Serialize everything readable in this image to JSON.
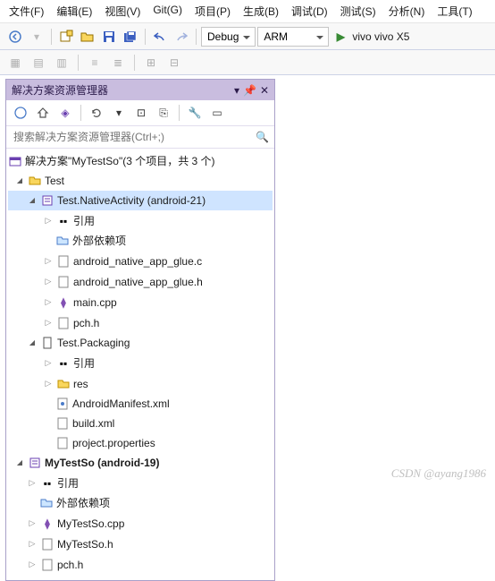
{
  "menu": [
    "文件(F)",
    "编辑(E)",
    "视图(V)",
    "Git(G)",
    "项目(P)",
    "生成(B)",
    "调试(D)",
    "测试(S)",
    "分析(N)",
    "工具(T)"
  ],
  "toolbar": {
    "config": "Debug",
    "platform": "ARM",
    "target": "vivo vivo X5"
  },
  "panel": {
    "title": "解决方案资源管理器",
    "search_placeholder": "搜索解决方案资源管理器(Ctrl+;)",
    "solution": "解决方案\"MyTestSo\"(3 个项目，共 3 个)",
    "nodes": {
      "test": "Test",
      "native": "Test.NativeActivity (android-21)",
      "ref1": "引用",
      "ext1": "外部依赖项",
      "glue_c": "android_native_app_glue.c",
      "glue_h": "android_native_app_glue.h",
      "main": "main.cpp",
      "pch1": "pch.h",
      "pkg": "Test.Packaging",
      "ref2": "引用",
      "res": "res",
      "manifest": "AndroidManifest.xml",
      "build": "build.xml",
      "props": "project.properties",
      "myso": "MyTestSo (android-19)",
      "ref3": "引用",
      "ext3": "外部依赖项",
      "so_cpp": "MyTestSo.cpp",
      "so_h": "MyTestSo.h",
      "pch3": "pch.h"
    }
  },
  "watermark": "CSDN @ayang1986"
}
